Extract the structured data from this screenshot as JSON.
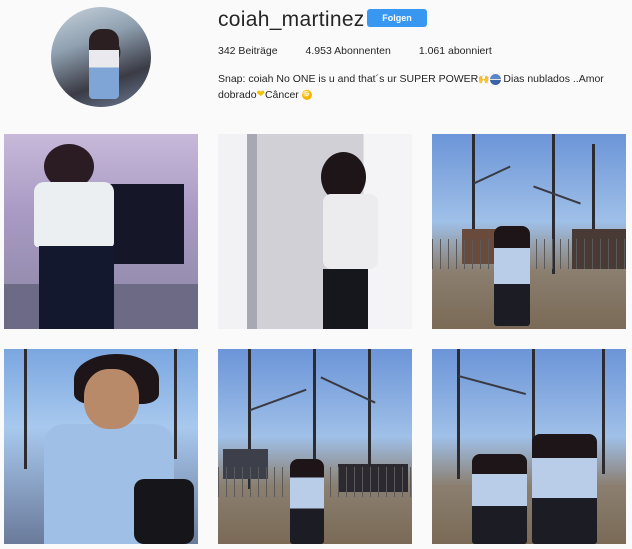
{
  "profile": {
    "username": "coiah_martinez",
    "follow_label": "Folgen",
    "stats": {
      "posts": "342 Beiträge",
      "followers": "4.953 Abonnenten",
      "following": "1.061 abonniert"
    },
    "bio_line1_text": "Snap: coiah No ONE is u and that´s ur SUPER POWER",
    "bio_line1_tail": " Dias nublados ..Amor",
    "bio_line2_text": "dobrado",
    "bio_line2_tail": "Câncer"
  },
  "grid": {
    "posts": [
      {
        "icon": "photo-indoor"
      },
      {
        "icon": "photo-doorway"
      },
      {
        "icon": "photo-outdoor-yard"
      },
      {
        "icon": "photo-closeup-denim"
      },
      {
        "icon": "photo-outdoor-trees"
      },
      {
        "icon": "photo-two-girls"
      }
    ]
  },
  "colors": {
    "accent": "#3897f0",
    "background": "#fafafa",
    "text": "#262626"
  }
}
